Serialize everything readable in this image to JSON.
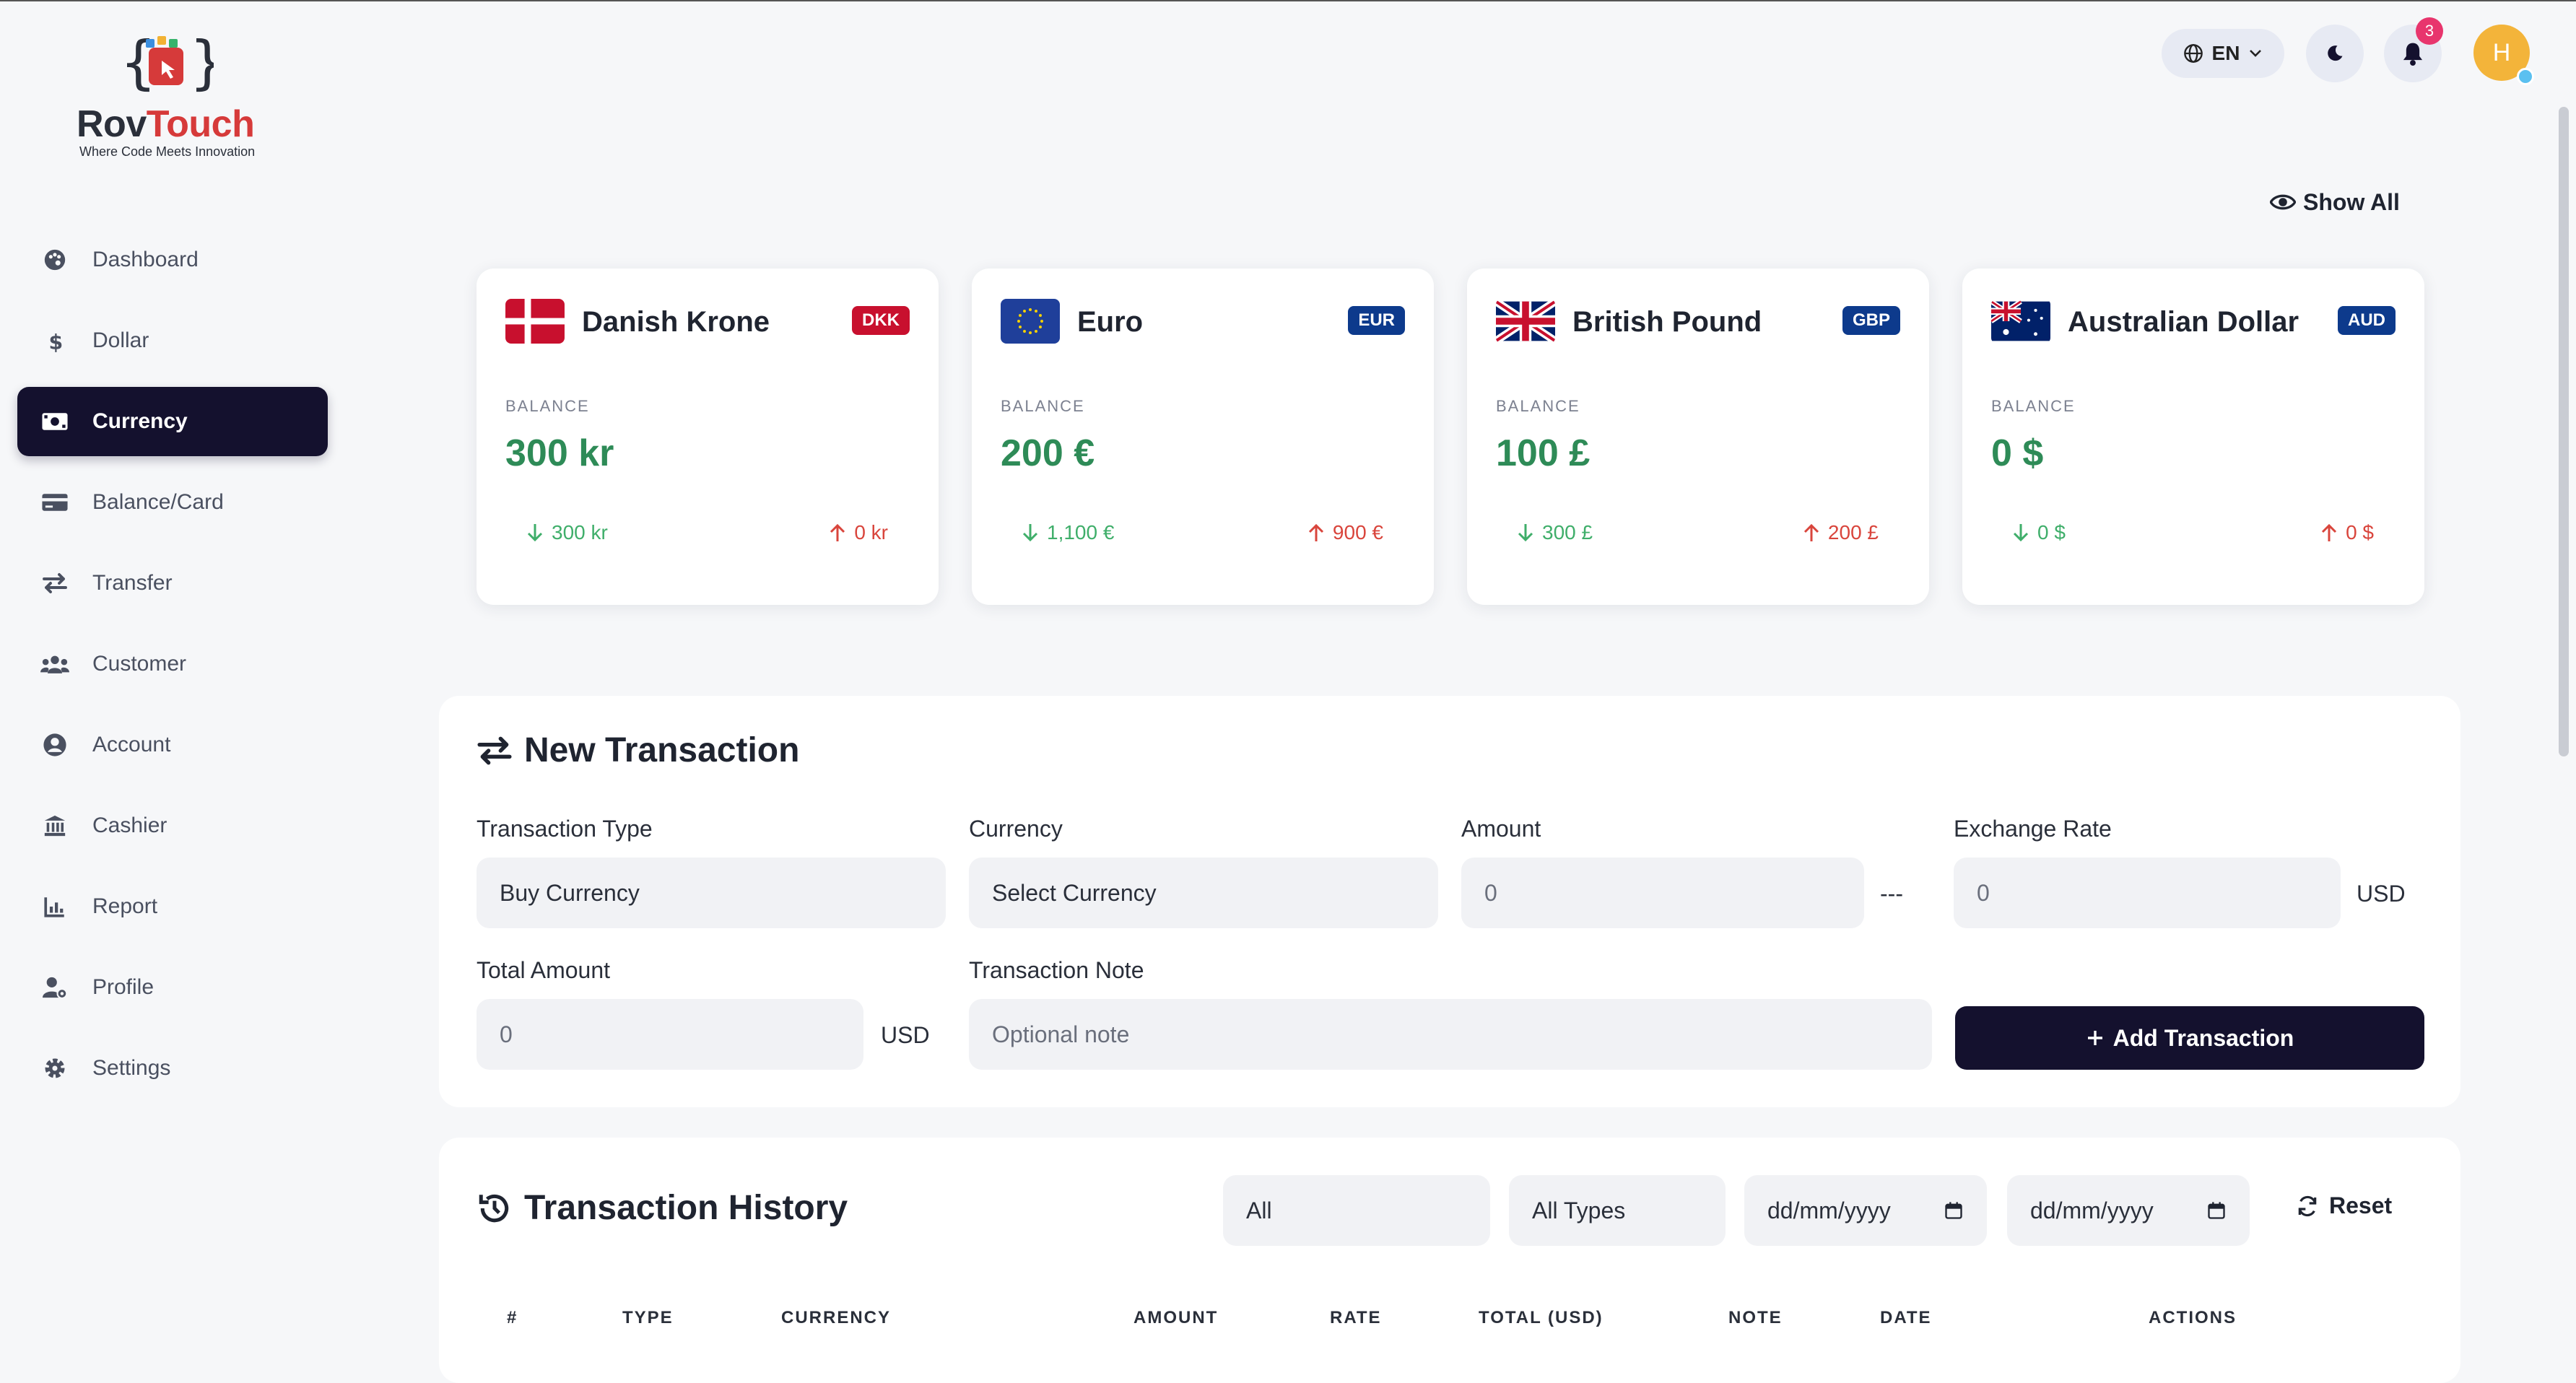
{
  "brand": {
    "name_part1": "Rov",
    "name_part2": "Touch",
    "tagline": "Where Code Meets Innovation"
  },
  "sidebar": {
    "items": [
      {
        "label": "Dashboard",
        "icon": "palette-icon"
      },
      {
        "label": "Dollar",
        "icon": "dollar-icon"
      },
      {
        "label": "Currency",
        "icon": "money-bill-icon",
        "active": true
      },
      {
        "label": "Balance/Card",
        "icon": "credit-card-icon"
      },
      {
        "label": "Transfer",
        "icon": "transfer-icon"
      },
      {
        "label": "Customer",
        "icon": "users-icon"
      },
      {
        "label": "Account",
        "icon": "user-circle-icon"
      },
      {
        "label": "Cashier",
        "icon": "bank-icon"
      },
      {
        "label": "Report",
        "icon": "chart-icon"
      },
      {
        "label": "Profile",
        "icon": "user-gear-icon"
      },
      {
        "label": "Settings",
        "icon": "gear-icon"
      }
    ]
  },
  "topbar": {
    "language": "EN",
    "notification_count": "3",
    "avatar_initial": "H"
  },
  "show_all_label": "Show All",
  "cards": [
    {
      "name": "Danish Krone",
      "code": "DKK",
      "code_color": "#c8102e",
      "balance_label": "BALANCE",
      "balance": "300 kr",
      "incoming": "300 kr",
      "outgoing": "0 kr"
    },
    {
      "name": "Euro",
      "code": "EUR",
      "code_color": "#0d3a8c",
      "balance_label": "BALANCE",
      "balance": "200 €",
      "incoming": "1,100 €",
      "outgoing": "900 €"
    },
    {
      "name": "British Pound",
      "code": "GBP",
      "code_color": "#0d3a8c",
      "balance_label": "BALANCE",
      "balance": "100 £",
      "incoming": "300 £",
      "outgoing": "200 £"
    },
    {
      "name": "Australian Dollar",
      "code": "AUD",
      "code_color": "#0d3a8c",
      "balance_label": "BALANCE",
      "balance": "0 $",
      "incoming": "0 $",
      "outgoing": "0 $"
    }
  ],
  "new_transaction": {
    "title": "New Transaction",
    "type_label": "Transaction Type",
    "type_value": "Buy Currency",
    "currency_label": "Currency",
    "currency_value": "Select Currency",
    "amount_label": "Amount",
    "amount_value": "0",
    "amount_suffix": "---",
    "rate_label": "Exchange Rate",
    "rate_value": "0",
    "rate_suffix": "USD",
    "total_label": "Total Amount",
    "total_value": "0",
    "total_suffix": "USD",
    "note_label": "Transaction Note",
    "note_placeholder": "Optional note",
    "add_button": "Add Transaction"
  },
  "history": {
    "title": "Transaction History",
    "filter_currency": "All",
    "filter_type": "All Types",
    "date_from": "dd/mm/yyyy",
    "date_to": "dd/mm/yyyy",
    "reset_label": "Reset",
    "columns": [
      "#",
      "TYPE",
      "CURRENCY",
      "AMOUNT",
      "RATE",
      "TOTAL (USD)",
      "NOTE",
      "DATE",
      "ACTIONS"
    ]
  },
  "colors": {
    "accent": "#14112e",
    "positive": "#2e8b57",
    "negative": "#d9453c"
  }
}
